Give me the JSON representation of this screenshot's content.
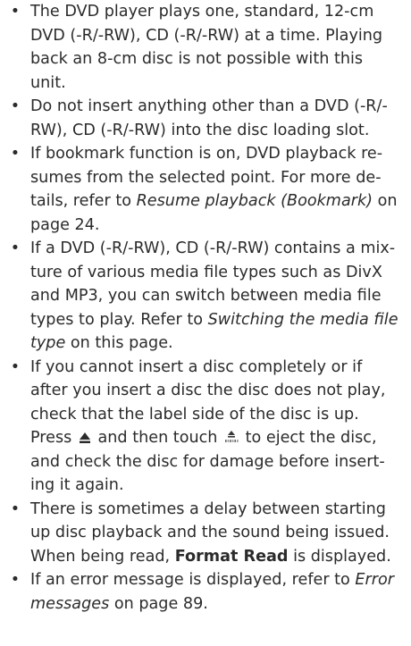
{
  "bullet_char": "•",
  "items": [
    {
      "lines": [
        [
          {
            "t": "The DVD player plays one, standard, 12-cm"
          }
        ],
        [
          {
            "t": "DVD (-R/-RW), CD (-R/-RW) at a time. Playing"
          }
        ],
        [
          {
            "t": "back an 8-cm disc is not possible with this"
          }
        ],
        [
          {
            "t": "unit."
          }
        ]
      ]
    },
    {
      "lines": [
        [
          {
            "t": "Do not insert anything other than a DVD (-R/-"
          }
        ],
        [
          {
            "t": "RW), CD (-R/-RW) into the disc loading slot."
          }
        ]
      ]
    },
    {
      "lines": [
        [
          {
            "t": "If bookmark function is on, DVD playback re-"
          }
        ],
        [
          {
            "t": "sumes from the selected point. For more de-"
          }
        ],
        [
          {
            "t": "tails, refer to "
          },
          {
            "t": "Resume playback (Bookmark)",
            "s": "i"
          },
          {
            "t": " on"
          }
        ],
        [
          {
            "t": "page 24."
          }
        ]
      ]
    },
    {
      "lines": [
        [
          {
            "t": "If a DVD (-R/-RW), CD (-R/-RW) contains a mix-"
          }
        ],
        [
          {
            "t": "ture of various media file types such as DivX"
          }
        ],
        [
          {
            "t": "and MP3, you can switch between media file"
          }
        ],
        [
          {
            "t": "types to play. Refer to "
          },
          {
            "t": "Switching the media file",
            "s": "i"
          }
        ],
        [
          {
            "t": "type",
            "s": "i"
          },
          {
            "t": " on this page."
          }
        ]
      ]
    },
    {
      "lines": [
        [
          {
            "t": "If you cannot insert a disc completely or if"
          }
        ],
        [
          {
            "t": "after you insert a disc the disc does not play,"
          }
        ],
        [
          {
            "t": "check that the label side of the disc is up."
          }
        ],
        [
          {
            "t": "Press "
          },
          {
            "icon": "eject-icon"
          },
          {
            "t": " and then touch "
          },
          {
            "icon": "eject-touch-key-icon"
          },
          {
            "t": " to eject the disc,"
          }
        ],
        [
          {
            "t": "and check the disc for damage before insert-"
          }
        ],
        [
          {
            "t": "ing it again."
          }
        ]
      ]
    },
    {
      "lines": [
        [
          {
            "t": "There is sometimes a delay between starting"
          }
        ],
        [
          {
            "t": "up disc playback and the sound being issued."
          }
        ],
        [
          {
            "t": "When being read, "
          },
          {
            "t": "Format Read",
            "s": "b"
          },
          {
            "t": " is displayed."
          }
        ]
      ]
    },
    {
      "lines": [
        [
          {
            "t": "If an error message is displayed, refer to "
          },
          {
            "t": "Error",
            "s": "i"
          }
        ],
        [
          {
            "t": "messages",
            "s": "i"
          },
          {
            "t": " on page 89."
          }
        ]
      ]
    }
  ]
}
